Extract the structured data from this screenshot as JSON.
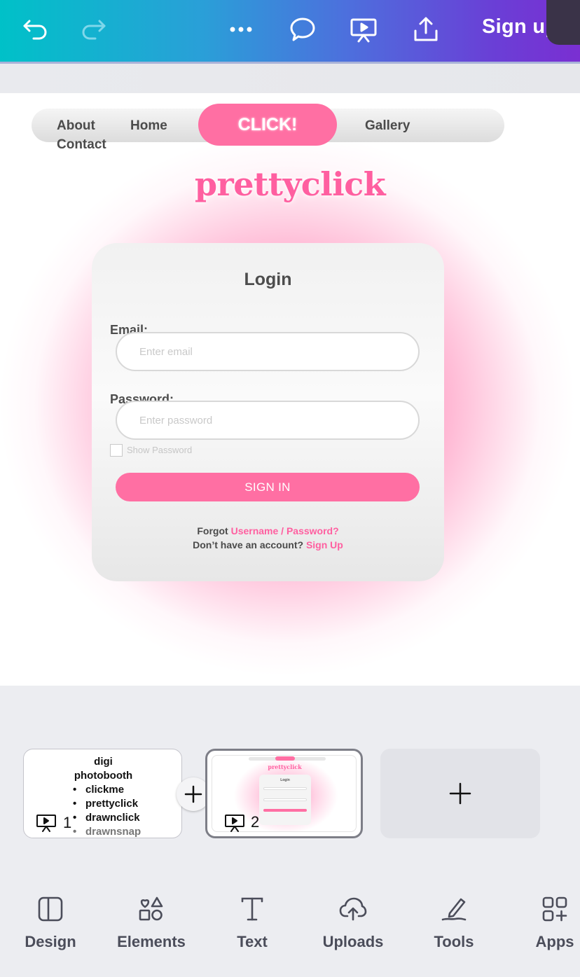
{
  "toolbar": {
    "undo_icon": "undo-icon",
    "redo_icon": "redo-icon",
    "more_icon": "more-dots-icon",
    "comment_icon": "comment-icon",
    "present_icon": "present-icon",
    "share_icon": "share-icon",
    "signup_label": "Sign up"
  },
  "design": {
    "nav": {
      "about": "About",
      "contact": "Contact",
      "home": "Home",
      "click": "CLICK!",
      "gallery": "Gallery"
    },
    "brand": "prettyclick",
    "login": {
      "title": "Login",
      "email_label": "Email:",
      "email_placeholder": "Enter email",
      "password_label": "Password:",
      "password_placeholder": "Enter password",
      "show_password": "Show Password",
      "signin": "SIGN IN",
      "forgot_prefix": "Forgot ",
      "forgot_link": "Username / Password?",
      "account_prefix": "Don’t have an account? ",
      "account_link": "Sign Up"
    }
  },
  "pages": [
    {
      "number": "1",
      "title_lines": [
        "digi",
        "photobooth"
      ],
      "items": [
        "clickme",
        "prettyclick",
        "drawnclick",
        "drawnsnap"
      ]
    },
    {
      "number": "2",
      "mini": {
        "about": "About",
        "contact": "Contact",
        "home": "Home",
        "click": "CLICK!",
        "gallery": "Gallery",
        "brand": "prettyclick",
        "title": "Login"
      }
    }
  ],
  "bottom_nav": [
    {
      "label": "Design",
      "icon": "design-icon"
    },
    {
      "label": "Elements",
      "icon": "elements-icon"
    },
    {
      "label": "Text",
      "icon": "text-icon"
    },
    {
      "label": "Uploads",
      "icon": "uploads-icon"
    },
    {
      "label": "Tools",
      "icon": "tools-icon"
    },
    {
      "label": "Apps",
      "icon": "apps-icon"
    }
  ]
}
